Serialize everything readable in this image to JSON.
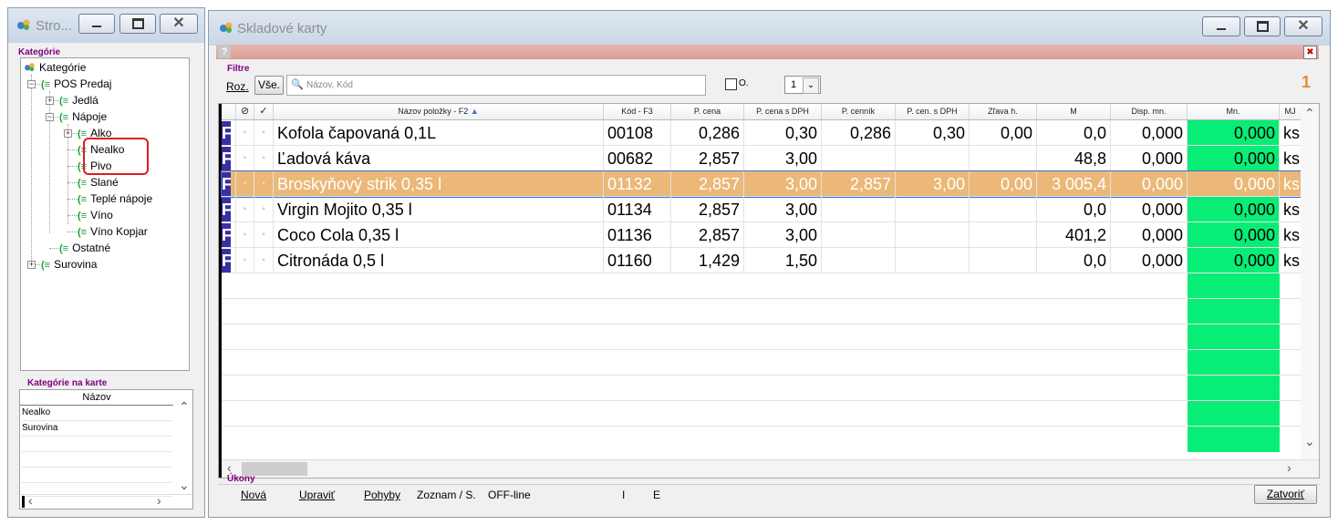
{
  "left_window": {
    "title": "Stro...",
    "categories_label": "Kategórie",
    "tree": [
      {
        "label": "Kategórie"
      },
      {
        "label": "POS Predaj"
      },
      {
        "label": "Jedlá"
      },
      {
        "label": "Nápoje"
      },
      {
        "label": "Alko"
      },
      {
        "label": "Nealko"
      },
      {
        "label": "Pivo"
      },
      {
        "label": "Slané"
      },
      {
        "label": "Teplé nápoje"
      },
      {
        "label": "Víno"
      },
      {
        "label": "Víno Kopjar"
      },
      {
        "label": "Ostatné"
      },
      {
        "label": "Surovina"
      }
    ],
    "card_categories_label": "Kategórie na karte",
    "card_table_header": "Názov",
    "card_table_rows": [
      "Nealko",
      "Surovina"
    ]
  },
  "main_window": {
    "title": "Skladové karty",
    "help_glyph": "?",
    "filters_label": "Filtre",
    "roz_label": "Roz.",
    "vse_label": "Vše.",
    "search_placeholder": "Názov, Kód",
    "checkbox_label": "O.",
    "combo_value": "1",
    "badge_count": "1",
    "columns": [
      "Názov položky - F2",
      "Kód - F3",
      "P. cena",
      "P. cena s DPH",
      "P. cenník",
      "P. cen. s DPH",
      "Zľava h.",
      "M",
      "Disp. mn.",
      "Mn.",
      "MJ"
    ],
    "rows": [
      {
        "name": "Kofola čapovaná 0,1L",
        "code": "00108",
        "pcena": "0,286",
        "pcena_dph": "0,30",
        "pcennik": "0,286",
        "pcen_dph": "0,30",
        "zlava": "0,00",
        "m": "0,0",
        "disp": "0,000",
        "mn": "0,000",
        "mj": "ks"
      },
      {
        "name": "Ľadová káva",
        "code": "00682",
        "pcena": "2,857",
        "pcena_dph": "3,00",
        "pcennik": "",
        "pcen_dph": "",
        "zlava": "",
        "m": "48,8",
        "disp": "0,000",
        "mn": "0,000",
        "mj": "ks"
      },
      {
        "name": "Broskyňový strik 0,35 l",
        "code": "01132",
        "pcena": "2,857",
        "pcena_dph": "3,00",
        "pcennik": "2,857",
        "pcen_dph": "3,00",
        "zlava": "0,00",
        "m": "3 005,4",
        "disp": "0,000",
        "mn": "0,000",
        "mj": "ks"
      },
      {
        "name": "Virgin Mojito 0,35 l",
        "code": "01134",
        "pcena": "2,857",
        "pcena_dph": "3,00",
        "pcennik": "",
        "pcen_dph": "",
        "zlava": "",
        "m": "0,0",
        "disp": "0,000",
        "mn": "0,000",
        "mj": "ks"
      },
      {
        "name": "Coco Cola 0,35 l",
        "code": "01136",
        "pcena": "2,857",
        "pcena_dph": "3,00",
        "pcennik": "",
        "pcen_dph": "",
        "zlava": "",
        "m": "401,2",
        "disp": "0,000",
        "mn": "0,000",
        "mj": "ks"
      },
      {
        "name": "Citronáda 0,5 l",
        "code": "01160",
        "pcena": "1,429",
        "pcena_dph": "1,50",
        "pcennik": "",
        "pcen_dph": "",
        "zlava": "",
        "m": "0,0",
        "disp": "0,000",
        "mn": "0,000",
        "mj": "ks"
      }
    ],
    "row_marker": "F",
    "selected_row_index": 2,
    "actions_label": "Úkony",
    "actions": [
      "Nová",
      "Upraviť",
      "Pohyby",
      "Zoznam / S.",
      "OFF-line",
      "I",
      "E"
    ],
    "close_button": "Zatvoriť"
  },
  "colors": {
    "selected_row": "#ebb878",
    "qty_column": "#08ed76",
    "row_marker": "#3a2fa0",
    "section_label": "#800080",
    "badge": "#e88a3a",
    "highlight_box": "#e01b24"
  }
}
